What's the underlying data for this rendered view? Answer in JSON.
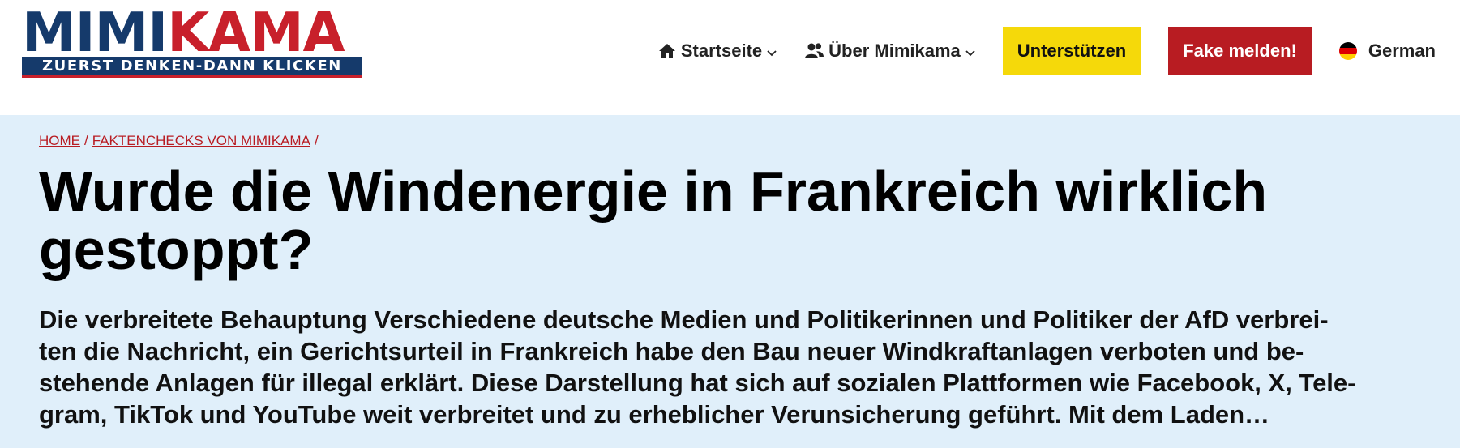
{
  "logo": {
    "text_part_a": "MIMI",
    "text_part_b": "KAMA",
    "tagline": "ZUERST DENKEN-DANN KLICKEN",
    "colors": {
      "blue": "#153a6b",
      "red": "#c8202b"
    }
  },
  "nav": {
    "items": [
      {
        "label": "Startseite",
        "icon": "home-icon"
      },
      {
        "label": "Über Mimikama",
        "icon": "users-icon"
      }
    ],
    "support_label": "Unterstützen",
    "fake_label": "Fake melden!",
    "language_label": "German",
    "colors": {
      "support": "#f5d90a",
      "fake": "#b81c22"
    }
  },
  "breadcrumb": {
    "home": "HOME",
    "category": "FAKTENCHECKS VON MIMIKAMA",
    "separator": "/"
  },
  "article": {
    "title": "Wurde die Windenergie in Frankreich wirklich gestoppt?",
    "excerpt_lines": [
      "Die verbreitete Behauptung Verschiedene deutsche Medien und Politikerinnen und Politiker der AfD verbrei-",
      "ten die Nachricht, ein Gerichtsurteil in Frankreich habe den Bau neuer Windkraftanlagen verboten und be-",
      "stehende Anlagen für illegal erklärt. Diese Darstellung hat sich auf sozialen Plattformen wie Facebook, X, Tele-",
      "gram, TikTok und YouTube weit verbreitet und zu erheblicher Verunsicherung geführt. Mit dem Laden…"
    ]
  },
  "hero_background": "#e0effa"
}
